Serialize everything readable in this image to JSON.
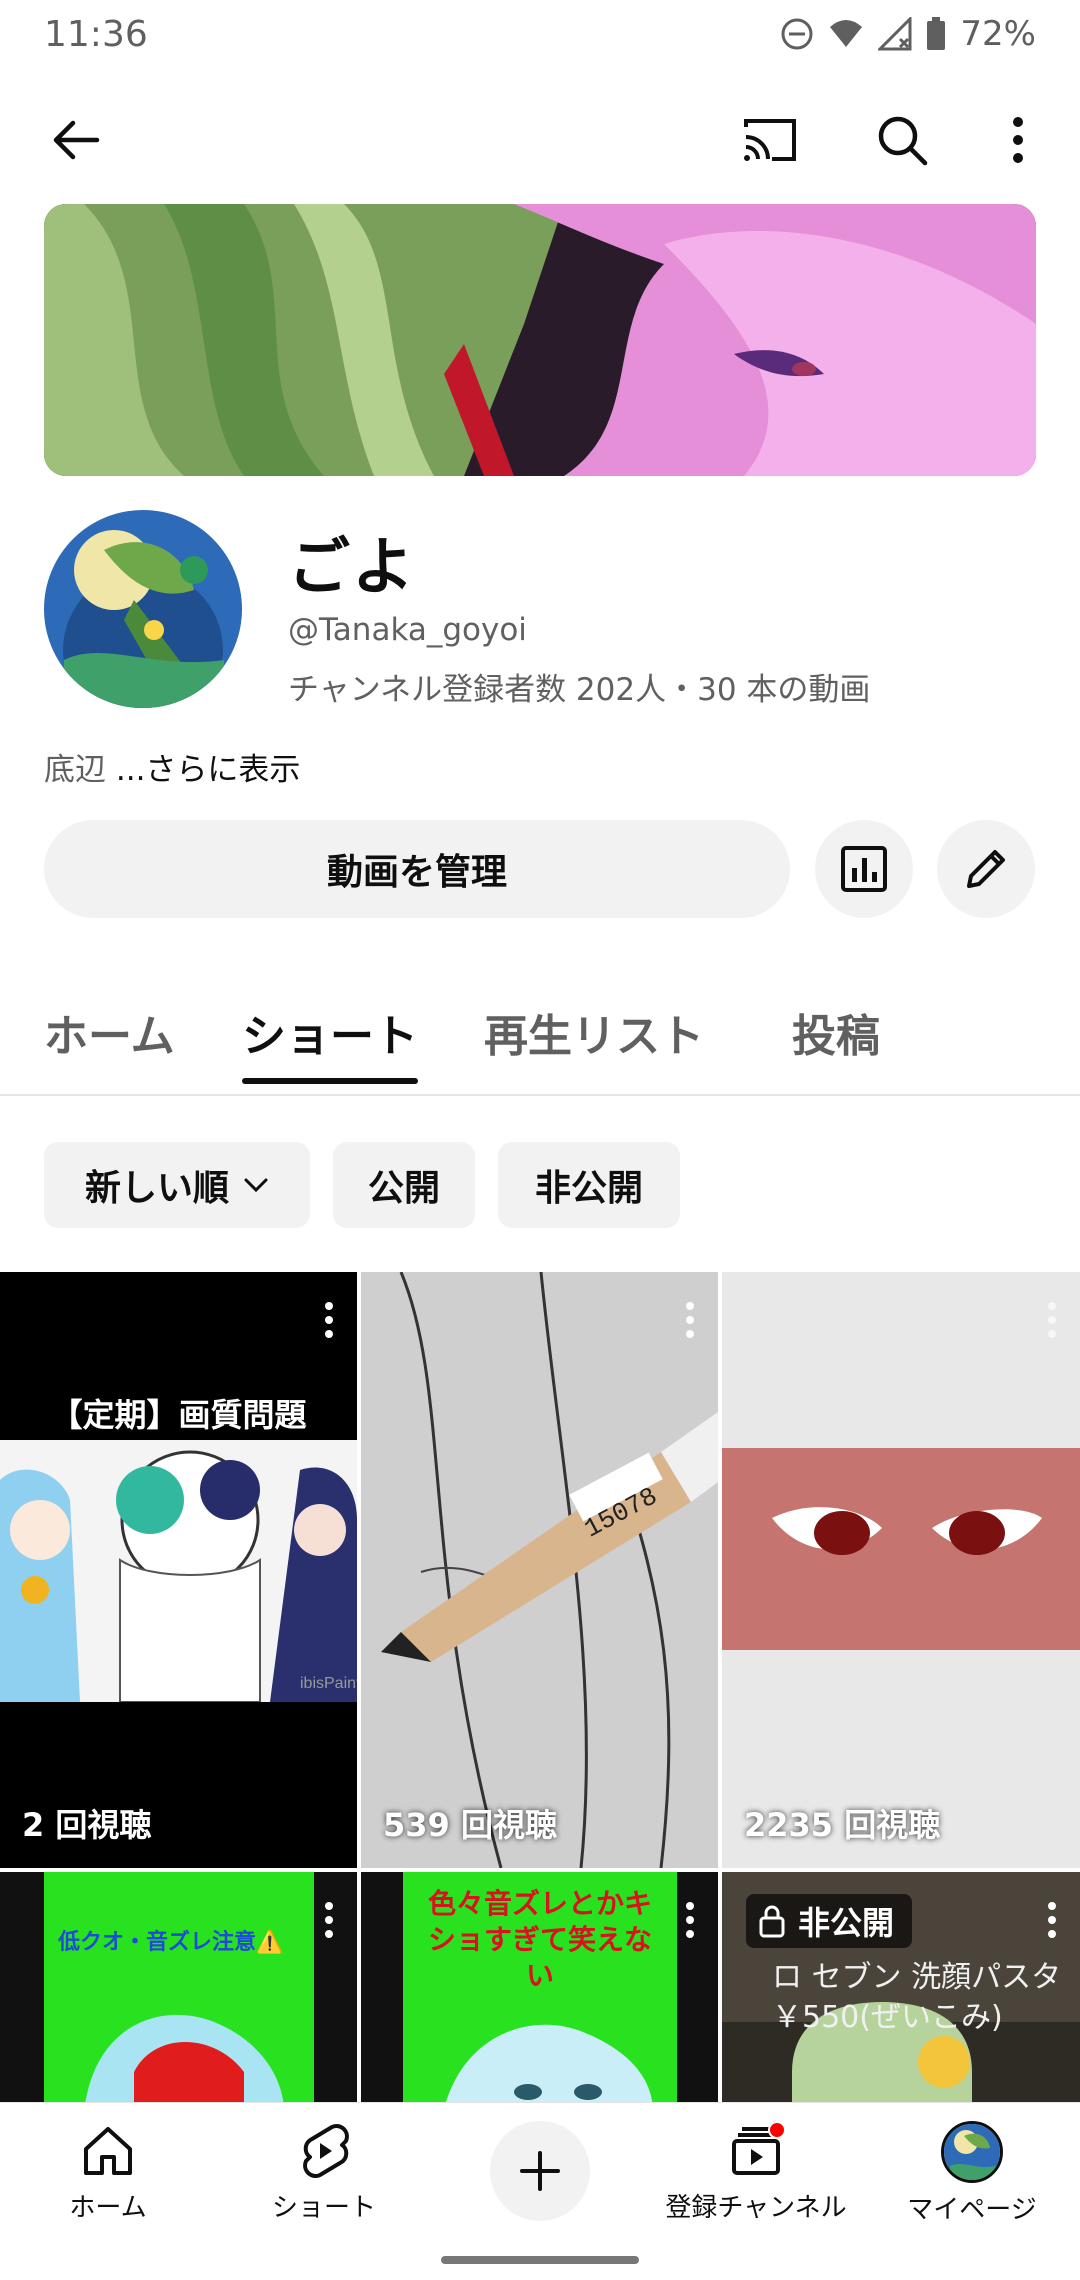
{
  "status_bar": {
    "time": "11:36",
    "battery": "72%"
  },
  "app_bar": {
    "icons": [
      "back-arrow-icon",
      "cast-icon",
      "search-icon",
      "more-vert-icon"
    ]
  },
  "channel": {
    "name": "ごよ",
    "handle": "@Tanaka_goyoi",
    "meta": "チャンネル登録者数 202人・30 本の動画",
    "description": "底辺",
    "more_label": "...さらに表示"
  },
  "actions": {
    "manage_label": "動画を管理"
  },
  "tabs": [
    {
      "label": "ホーム",
      "active": false
    },
    {
      "label": "ショート",
      "active": true
    },
    {
      "label": "再生リスト",
      "active": false
    },
    {
      "label": "投稿",
      "active": false
    }
  ],
  "chips": {
    "sort": "新しい順",
    "public": "公開",
    "private": "非公開"
  },
  "shorts": [
    {
      "views": "2 回視聴",
      "title_overlay": "【定期】画質問題"
    },
    {
      "views": "539 回視聴"
    },
    {
      "views": "2235 回視聴"
    },
    {
      "caption": "低クオ・音ズレ注意⚠️"
    },
    {
      "caption": "色々音ズレとかキショすぎて笑えない"
    },
    {
      "badge": "非公開",
      "caption": "ロ セブン 洗顔パスタ ￥550(ぜいこみ)"
    }
  ],
  "bottom_nav": {
    "home": "ホーム",
    "shorts": "ショート",
    "subscriptions": "登録チャンネル",
    "you": "マイページ"
  },
  "colors": {
    "accent": "#0f0f0f",
    "chip_bg": "#f2f2f2",
    "notification": "#ff0000"
  }
}
